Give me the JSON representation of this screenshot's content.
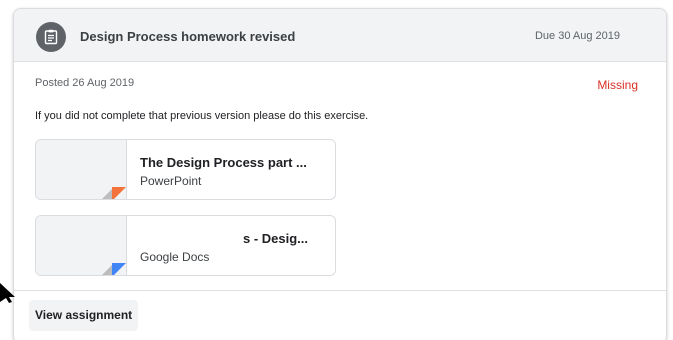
{
  "header": {
    "icon": "assignment-icon",
    "title": "Design Process homework revised",
    "due": "Due 30 Aug 2019"
  },
  "body": {
    "posted": "Posted 26 Aug 2019",
    "status": "Missing",
    "description": "If you did not complete that previous version please do this exercise."
  },
  "attachments": [
    {
      "title": "The Design Process part ...",
      "type": "PowerPoint",
      "icon": "powerpoint-file-icon",
      "color": "#f4733a"
    },
    {
      "title": "s - Desig...",
      "type": "Google Docs",
      "icon": "google-docs-file-icon",
      "color": "#4285f4"
    }
  ],
  "actions": {
    "view_assignment": "View assignment"
  },
  "colors": {
    "missing": "#d93025",
    "header_bg": "#f1f3f4"
  }
}
